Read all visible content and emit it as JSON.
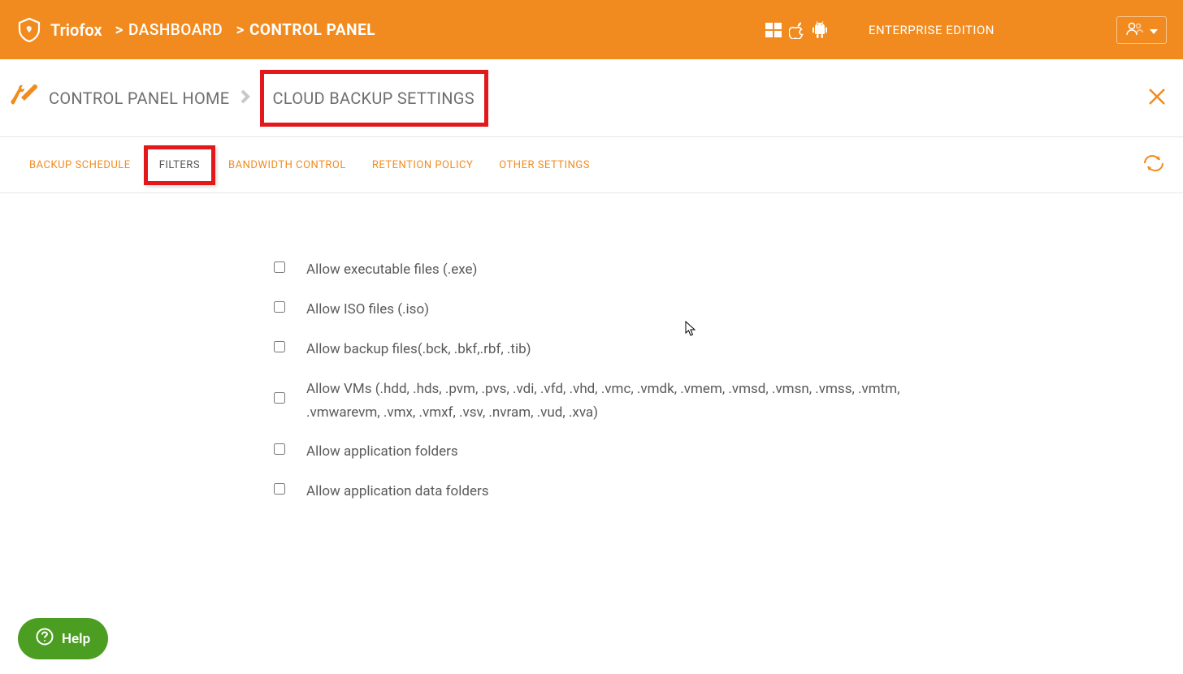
{
  "header": {
    "brand": "Triofox",
    "breadcrumb": [
      "DASHBOARD",
      "CONTROL PANEL"
    ],
    "edition": "ENTERPRISE EDITION"
  },
  "subheader": {
    "breadcrumb": [
      "CONTROL PANEL HOME",
      "CLOUD BACKUP SETTINGS"
    ]
  },
  "tabs": {
    "items": [
      {
        "label": "BACKUP SCHEDULE",
        "active": false
      },
      {
        "label": "FILTERS",
        "active": true
      },
      {
        "label": "BANDWIDTH CONTROL",
        "active": false
      },
      {
        "label": "RETENTION POLICY",
        "active": false
      },
      {
        "label": "OTHER SETTINGS",
        "active": false
      }
    ]
  },
  "filters": {
    "items": [
      {
        "label": "Allow executable files (.exe)",
        "checked": false
      },
      {
        "label": "Allow ISO files (.iso)",
        "checked": false
      },
      {
        "label": "Allow backup files(.bck, .bkf,.rbf, .tib)",
        "checked": false
      },
      {
        "label": "Allow VMs (.hdd, .hds, .pvm, .pvs, .vdi, .vfd, .vhd, .vmc, .vmdk, .vmem, .vmsd, .vmsn, .vmss, .vmtm, .vmwarevm, .vmx, .vmxf, .vsv, .nvram, .vud, .xva)",
        "checked": false
      },
      {
        "label": "Allow application folders",
        "checked": false
      },
      {
        "label": "Allow application data folders",
        "checked": false
      }
    ]
  },
  "help": {
    "label": "Help"
  }
}
